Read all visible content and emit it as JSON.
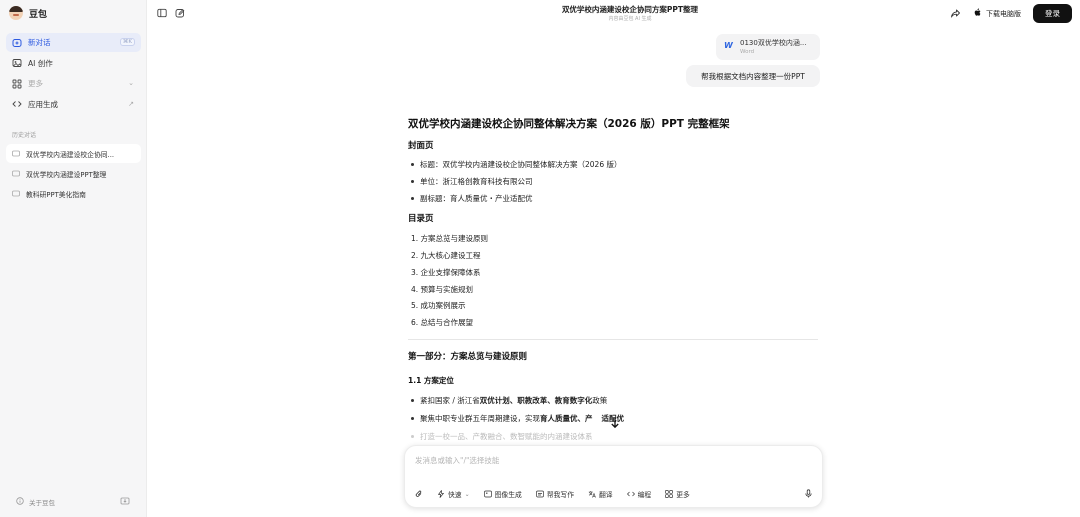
{
  "app": {
    "name": "豆包"
  },
  "header": {
    "title": "双优学校内涵建设校企协同方案PPT整理",
    "subtitle": "内容由豆包 AI 生成",
    "download_label": "下载电脑版",
    "login_label": "登录"
  },
  "sidebar": {
    "items": [
      {
        "label": "新对话",
        "shortcut": "⌘K"
      },
      {
        "label": "AI 创作"
      },
      {
        "label": "更多"
      },
      {
        "label": "应用生成"
      }
    ],
    "history_title": "历史对话",
    "history": [
      {
        "label": "双优学校内涵建设校企协同..."
      },
      {
        "label": "双优学校内涵建设PPT整理"
      },
      {
        "label": "教科研PPT美化指南"
      }
    ],
    "about_label": "关于豆包"
  },
  "chat": {
    "file": {
      "name": "0130双优学校内涵...",
      "type": "Word"
    },
    "user_message": "帮我根据文档内容整理一份PPT",
    "answer": {
      "title": "双优学校内涵建设校企协同整体解决方案（2026 版）PPT 完整框架",
      "cover_heading": "封面页",
      "cover_items": [
        "标题：双优学校内涵建设校企协同整体解决方案（2026 版）",
        "单位：浙江格创教育科技有限公司",
        "副标题：育人质量优・产业适配优"
      ],
      "toc_heading": "目录页",
      "toc_items": [
        "1. 方案总览与建设原则",
        "2. 九大核心建设工程",
        "3. 企业支撑保障体系",
        "4. 预算与实施规划",
        "5. 成功案例展示",
        "6. 总结与合作展望"
      ],
      "part1_heading": "第一部分：方案总览与建设原则",
      "section_heading": "1.1 方案定位",
      "bullet1_pre": "紧扣国家 / 浙江省",
      "bullet1_bold": "双优计划、职教改革、教育数字化",
      "bullet1_post": "政策",
      "bullet2_pre": "聚焦中职专业群五年周期建设，实现",
      "bullet2_bold": "育人质量优、产",
      "bullet2_bold2": "适配优",
      "bullet3": "打造一校一品、产教融合、数智赋能的内涵建设体系"
    }
  },
  "composer": {
    "placeholder": "发消息或输入\"/\"选择技能",
    "tools": [
      {
        "label": "快速",
        "icon": "lightning-icon"
      },
      {
        "label": "图像生成",
        "icon": "image-icon"
      },
      {
        "label": "帮我写作",
        "icon": "write-icon"
      },
      {
        "label": "翻译",
        "icon": "translate-icon"
      },
      {
        "label": "编程",
        "icon": "code-icon"
      },
      {
        "label": "更多",
        "icon": "grid-icon"
      }
    ]
  },
  "colors": {
    "accent": "#2c59e0",
    "active_bg": "#e8ecf9",
    "sidebar_bg": "#f6f6f7",
    "login_bg": "#111111"
  }
}
